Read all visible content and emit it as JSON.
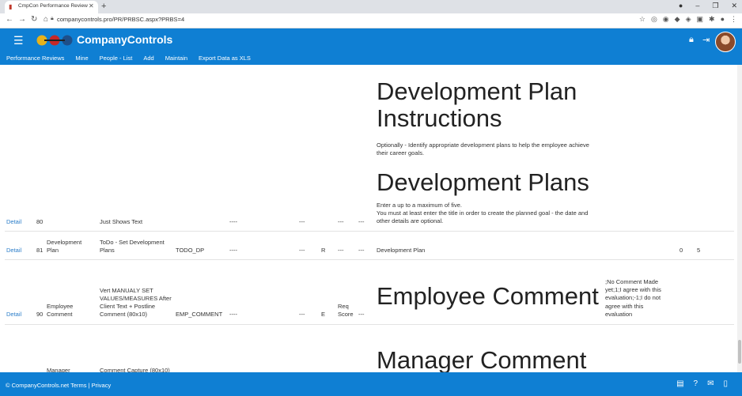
{
  "browser": {
    "tab_title": "CmpCon Performance Review",
    "url": "companycontrols.pro/PR/PRBSC.aspx?PRBS=4",
    "win_minimize": "–",
    "win_maximize": "❐",
    "win_close": "✕"
  },
  "app": {
    "brand": "CompanyControls",
    "menu": [
      "Performance Reviews",
      "Mine",
      "People - List",
      "Add",
      "Maintain",
      "Export Data as XLS"
    ]
  },
  "content": {
    "dev_plan_instructions_title_1": "Development Plan",
    "dev_plan_instructions_title_2": "Instructions",
    "dev_plan_instructions_text_1": "Optionally - Identify appropriate development plans to help the employee achieve",
    "dev_plan_instructions_text_2": "their career goals.",
    "dev_plans_title": "Development Plans",
    "dev_plans_text_1": "Enter a up to a maximum of five.",
    "dev_plans_text_2": "You must at least enter the title in order to create the planned goal - the date and",
    "dev_plans_text_3": "other details are optional.",
    "employee_comment_title": "Employee Comment",
    "manager_comment_title": "Manager Comment"
  },
  "rows": [
    {
      "detail": "Detail",
      "seq": "80",
      "section": "",
      "description": "Just Shows Text",
      "code": "",
      "d1": "----",
      "d2": "---",
      "flag": "",
      "d3": "---",
      "d4": "---",
      "label": "",
      "n1": "",
      "n2": ""
    },
    {
      "detail": "Detail",
      "seq": "81",
      "section_1": "Development",
      "section_2": "Plan",
      "description_1": "ToDo - Set Development",
      "description_2": "Plans",
      "code": "TODO_DP",
      "d1": "----",
      "d2": "---",
      "flag": "R",
      "d3": "---",
      "d4": "---",
      "label": "Development Plan",
      "n1": "0",
      "n2": "5"
    },
    {
      "detail": "Detail",
      "seq": "90",
      "section_1": "Employee",
      "section_2": "Comment",
      "description_1": "Vert MANUALY SET",
      "description_2": "VALUES/MEASURES After",
      "description_3": "Client Text + Postline",
      "description_4": "Comment (80x10)",
      "code": "EMP_COMMENT",
      "d1": "----",
      "d2": "---",
      "flag": "E",
      "d3_1": "Req",
      "d3_2": "Score",
      "d4": "---",
      "options_1": ";No Comment Made",
      "options_2": "yet;1;I agree with this",
      "options_3": "evaluation;-1;I do not",
      "options_4": "agree with this",
      "options_5": "evaluation"
    },
    {
      "section_1": "Manager",
      "description_1": "Comment Capture (80x10)"
    }
  ],
  "footer": {
    "text": "© CompanyControls.net Terms | Privacy"
  },
  "colors": {
    "brand_blue": "#0f7fd3",
    "link_blue": "#2a7dc9"
  }
}
